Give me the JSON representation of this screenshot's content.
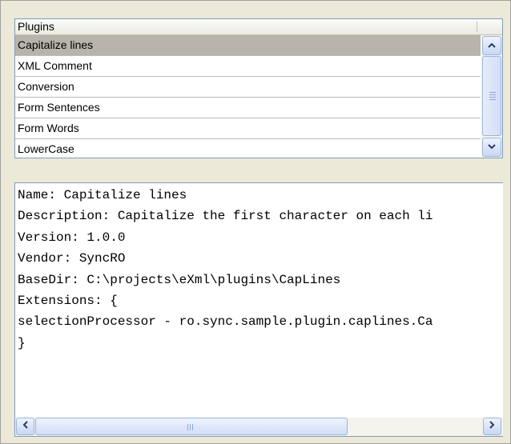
{
  "plugins_table": {
    "header": "Plugins",
    "rows": [
      "Capitalize lines",
      "XML Comment",
      "Conversion",
      "Form Sentences",
      "Form Words",
      "LowerCase"
    ],
    "selected": "Capitalize lines"
  },
  "details": {
    "lines": [
      "Name: Capitalize lines",
      "Description: Capitalize the first character on each li",
      "Version: 1.0.0",
      "Vendor: SyncRO",
      "BaseDir: C:\\projects\\eXml\\plugins\\CapLines",
      "Extensions: {",
      "selectionProcessor - ro.sync.sample.plugin.caplines.Ca",
      "}"
    ]
  },
  "icons": {
    "scroll_up": "chevron-up-icon",
    "scroll_down": "chevron-down-icon",
    "scroll_left": "chevron-left-icon",
    "scroll_right": "chevron-right-icon"
  },
  "colors": {
    "selection": "#b8b4ac",
    "border": "#7f9db9",
    "panel_bg": "#ece9d8"
  }
}
